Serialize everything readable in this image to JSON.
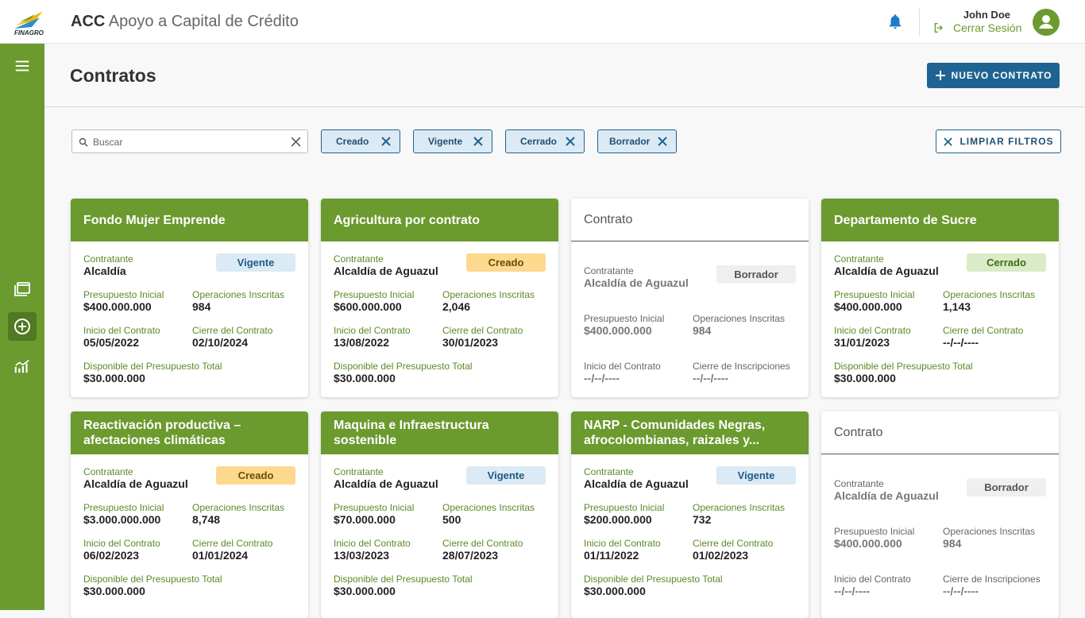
{
  "header": {
    "logo_text": "FINAGRO",
    "app_title_strong": "ACC",
    "app_title_rest": "Apoyo a Capital de Crédito",
    "user_name": "John Doe",
    "logout_label": "Cerrar Sesión"
  },
  "sidebar": {
    "items": [
      {
        "icon": "menu-icon"
      },
      {
        "icon": "folders-icon"
      },
      {
        "icon": "add-circle-icon",
        "active": true
      },
      {
        "icon": "analytics-icon"
      }
    ]
  },
  "page": {
    "title": "Contratos",
    "new_button_label": "NUEVO CONTRATO"
  },
  "filters": {
    "search_placeholder": "Buscar",
    "search_value": "",
    "chips": [
      "Creado",
      "Vigente",
      "Cerrado",
      "Borrador"
    ],
    "clear_label": "LIMPIAR FILTROS"
  },
  "labels": {
    "contratante": "Contratante",
    "presupuesto": "Presupuesto Inicial",
    "operaciones": "Operaciones Inscritas",
    "inicio": "Inicio del Contrato",
    "cierre": "Cierre del Contrato",
    "cierre_insc": "Cierre de Inscripciones",
    "disponible": "Disponible del Presupuesto Total"
  },
  "cards": [
    {
      "title": "Fondo Mujer Emprende",
      "status": "Vigente",
      "status_class": "vigente",
      "contratante": "Alcaldía",
      "presupuesto": "$400.000.000",
      "operaciones": "984",
      "inicio": "05/05/2022",
      "cierre": "02/10/2024",
      "disponible": "$30.000.000"
    },
    {
      "title": "Agricultura por contrato",
      "status": "Creado",
      "status_class": "creado",
      "contratante": "Alcaldía de Aguazul",
      "presupuesto": "$600.000.000",
      "operaciones": "2,046",
      "inicio": "13/08/2022",
      "cierre": "30/01/2023",
      "disponible": "$30.000.000"
    },
    {
      "title": "Contrato",
      "status": "Borrador",
      "status_class": "borrador",
      "draft": true,
      "contratante": "Alcaldía de Aguazul",
      "presupuesto": "$400.000.000",
      "operaciones": "984",
      "inicio": "--/--/----",
      "cierre": "--/--/----"
    },
    {
      "title": "Departamento de Sucre",
      "status": "Cerrado",
      "status_class": "cerrado",
      "contratante": "Alcaldía de Aguazul",
      "presupuesto": "$400.000.000",
      "operaciones": "1,143",
      "inicio": "31/01/2023",
      "cierre": "--/--/----",
      "disponible": "$30.000.000"
    },
    {
      "title": "Reactivación productiva – afectaciones climáticas",
      "status": "Creado",
      "status_class": "creado",
      "contratante": "Alcaldía de Aguazul",
      "presupuesto": "$3.000.000.000",
      "operaciones": "8,748",
      "inicio": "06/02/2023",
      "cierre": "01/01/2024",
      "disponible": "$30.000.000"
    },
    {
      "title": "Maquina e Infraestructura sostenible",
      "status": "Vigente",
      "status_class": "vigente",
      "contratante": "Alcaldía de Aguazul",
      "presupuesto": "$70.000.000",
      "operaciones": "500",
      "inicio": "13/03/2023",
      "cierre": "28/07/2023",
      "disponible": "$30.000.000"
    },
    {
      "title": "NARP - Comunidades Negras, afrocolombianas, raizales y...",
      "status": "Vigente",
      "status_class": "vigente",
      "contratante": "Alcaldía de Aguazul",
      "presupuesto": "$200.000.000",
      "operaciones": "732",
      "inicio": "01/11/2022",
      "cierre": "01/02/2023",
      "disponible": "$30.000.000"
    },
    {
      "title": "Contrato",
      "status": "Borrador",
      "status_class": "borrador",
      "draft": true,
      "contratante": "Alcaldía de Aguazul",
      "presupuesto": "$400.000.000",
      "operaciones": "984",
      "inicio": "--/--/----",
      "cierre": "--/--/----"
    }
  ]
}
